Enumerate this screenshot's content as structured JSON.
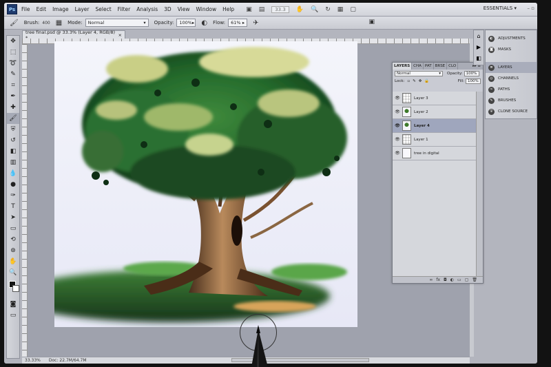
{
  "app": {
    "logo": "Ps",
    "menu": [
      "File",
      "Edit",
      "Image",
      "Layer",
      "Select",
      "Filter",
      "Analysis",
      "3D",
      "View",
      "Window",
      "Help"
    ],
    "zoom_display": "33.3",
    "workspace": "ESSENTIALS"
  },
  "options": {
    "brush_label": "Brush:",
    "brush_size": "400",
    "mode_label": "Mode:",
    "mode_value": "Normal",
    "opacity_label": "Opacity:",
    "opacity_value": "100%",
    "flow_label": "Flow:",
    "flow_value": "61%"
  },
  "document": {
    "tab_title": "tree final.psd @ 33.3% (Layer 4, RGB/8) *",
    "status_zoom": "33.33%",
    "status_doc": "Doc: 22.7M/64.7M"
  },
  "layers_panel": {
    "tabs": [
      "LAYERS",
      "CHA",
      "PAT",
      "BRSE",
      "CLO"
    ],
    "blend_mode": "Normal",
    "opacity_label": "Opacity:",
    "opacity_value": "100%",
    "lock_label": "Lock:",
    "fill_label": "Fill:",
    "fill_value": "100%",
    "layers": [
      {
        "name": "Layer 3",
        "selected": false,
        "thumb": "transparent"
      },
      {
        "name": "Layer 2",
        "selected": false,
        "thumb": "tree"
      },
      {
        "name": "Layer 4",
        "selected": true,
        "thumb": "tree"
      },
      {
        "name": "Layer 1",
        "selected": false,
        "thumb": "transparent"
      },
      {
        "name": "tree in digital",
        "selected": false,
        "thumb": "white"
      }
    ]
  },
  "dock": {
    "items": [
      {
        "label": "ADJUSTMENTS",
        "icon": "adjustments-icon"
      },
      {
        "label": "MASKS",
        "icon": "masks-icon"
      },
      {
        "label": "LAYERS",
        "icon": "layers-icon",
        "active": true
      },
      {
        "label": "CHANNELS",
        "icon": "channels-icon"
      },
      {
        "label": "PATHS",
        "icon": "paths-icon"
      },
      {
        "label": "BRUSHES",
        "icon": "brushes-icon"
      },
      {
        "label": "CLONE SOURCE",
        "icon": "clone-source-icon"
      }
    ]
  }
}
